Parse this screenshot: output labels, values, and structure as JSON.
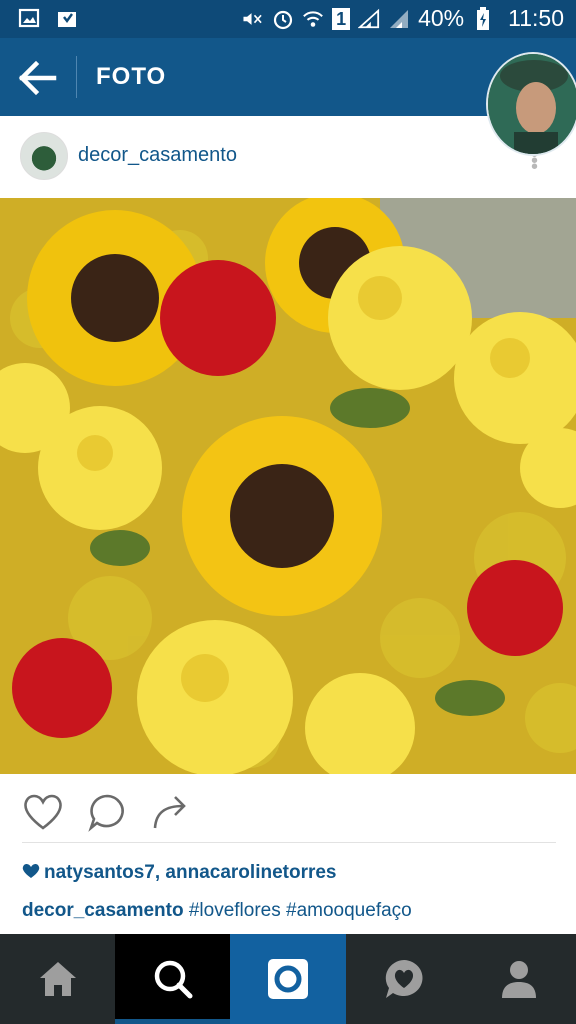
{
  "status_bar": {
    "battery_percent": "40%",
    "time": "11:50",
    "sim_label": "1"
  },
  "app_bar": {
    "title": "FOTO"
  },
  "post": {
    "username": "decor_casamento",
    "likes": "natysantos7, annacarolinetorres",
    "caption_user": "decor_casamento",
    "caption_text": " #loveflores #amooquefaço"
  },
  "colors": {
    "status_bar": "#0e4a78",
    "app_bar": "#12578a",
    "link": "#12578a",
    "tab_bar": "#242a2c",
    "tab_search_active": "#000000",
    "tab_camera": "#1261a0"
  },
  "tabs": [
    {
      "icon": "home-icon"
    },
    {
      "icon": "search-icon"
    },
    {
      "icon": "camera-icon"
    },
    {
      "icon": "activity-icon"
    },
    {
      "icon": "profile-icon"
    }
  ]
}
